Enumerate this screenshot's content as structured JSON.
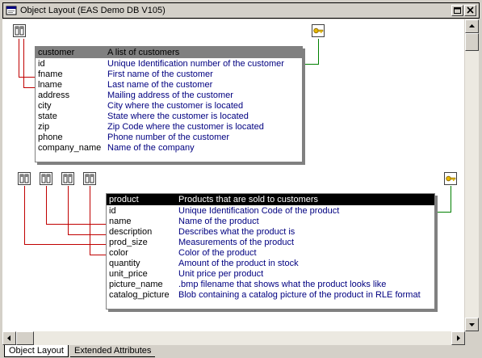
{
  "window": {
    "title": "Object Layout (EAS Demo DB V105)"
  },
  "tabs": [
    {
      "label": "Object Layout",
      "active": true
    },
    {
      "label": "Extended Attributes",
      "active": false
    }
  ],
  "customer_table": {
    "name": "customer",
    "description": "A list of customers",
    "columns": [
      {
        "name": "id",
        "desc": "Unique Identification number of the customer"
      },
      {
        "name": "fname",
        "desc": "First name of the customer"
      },
      {
        "name": "lname",
        "desc": "Last name of the customer"
      },
      {
        "name": "address",
        "desc": "Mailing address of the customer"
      },
      {
        "name": "city",
        "desc": "City where the customer is located"
      },
      {
        "name": "state",
        "desc": "State where the customer is located"
      },
      {
        "name": "zip",
        "desc": "Zip Code where the customer is located"
      },
      {
        "name": "phone",
        "desc": "Phone number of the customer"
      },
      {
        "name": "company_name",
        "desc": "Name of the company"
      }
    ]
  },
  "product_table": {
    "name": "product",
    "description": "Products that are sold to customers",
    "columns": [
      {
        "name": "id",
        "desc": "Unique Identification Code of the product"
      },
      {
        "name": "name",
        "desc": "Name of the product"
      },
      {
        "name": "description",
        "desc": "Describes what the product is"
      },
      {
        "name": "prod_size",
        "desc": "Measurements of the product"
      },
      {
        "name": "color",
        "desc": "Color of the product"
      },
      {
        "name": "quantity",
        "desc": "Amount of the product in stock"
      },
      {
        "name": "unit_price",
        "desc": "Unit price per product"
      },
      {
        "name": "picture_name",
        "desc": ".bmp filename that shows what the product looks like"
      },
      {
        "name": "catalog_picture",
        "desc": "Blob containing a catalog picture of the product in RLE format"
      }
    ]
  },
  "icons": {
    "column_object": "column-object-icon",
    "key": "key-icon",
    "window": "window-icon"
  },
  "colors": {
    "link_red": "#c00000",
    "link_green": "#008000",
    "column_desc": "#000080"
  }
}
